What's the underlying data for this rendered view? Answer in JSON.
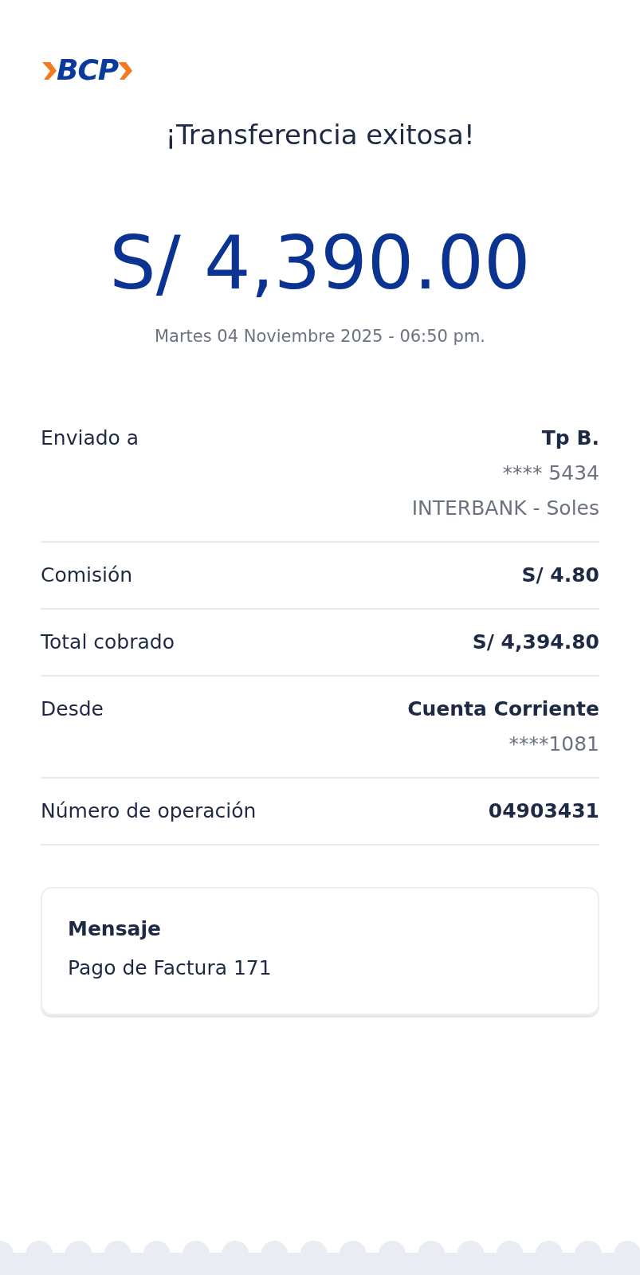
{
  "logo": {
    "text": "BCP"
  },
  "title": "¡Transferencia exitosa!",
  "amount": "S/ 4,390.00",
  "date": "Martes 04 Noviembre 2025 - 06:50 pm.",
  "details": [
    {
      "label": "Enviado a",
      "values": [
        "Tp B.",
        "**** 5434",
        "INTERBANK - Soles"
      ]
    },
    {
      "label": "Comisión",
      "values": [
        "S/ 4.80"
      ]
    },
    {
      "label": "Total cobrado",
      "values": [
        "S/ 4,394.80"
      ]
    },
    {
      "label": "Desde",
      "values": [
        "Cuenta Corriente",
        "****1081"
      ]
    },
    {
      "label": "Número de operación",
      "values": [
        "04903431"
      ]
    }
  ],
  "message": {
    "title": "Mensaje",
    "text": "Pago de Factura 171"
  }
}
